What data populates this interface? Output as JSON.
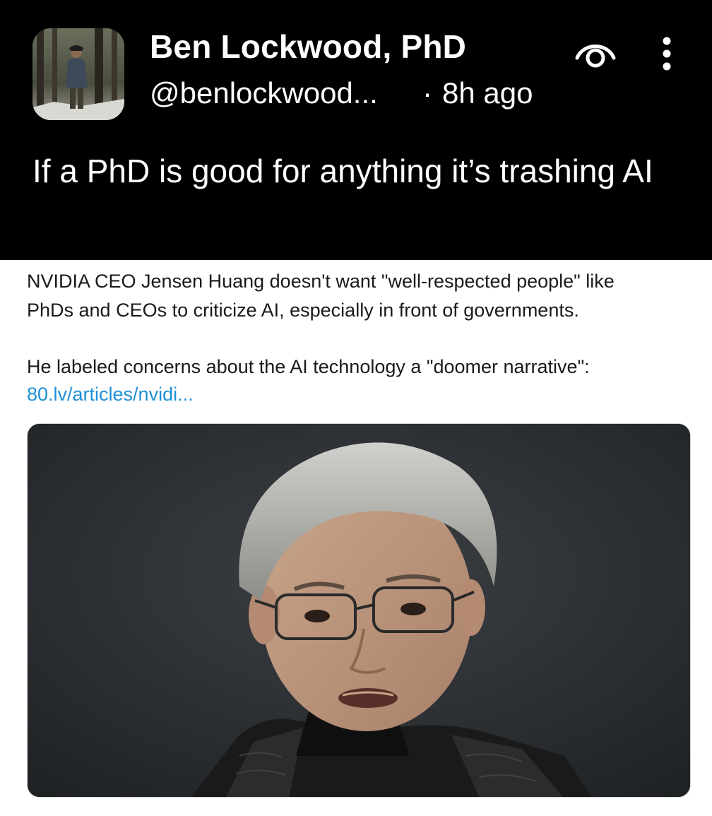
{
  "post": {
    "author_name": "Ben Lockwood, PhD",
    "handle": "@benlockwood...",
    "separator": "·",
    "time": "8h ago",
    "text": "If a PhD is good for anything it’s trashing AI",
    "icons": {
      "avatar": "avatar-photo-man-in-forest",
      "follow": "eye-icon",
      "more": "more-vertical-icon"
    }
  },
  "quoted": {
    "line1": "NVIDIA CEO Jensen Huang doesn't want \"well-respected people\" like",
    "line2": "PhDs and CEOs to criticize AI, especially in front of governments.",
    "line3": "He labeled concerns about the AI technology a \"doomer narrative\":",
    "link": "80.lv/articles/nvidi...",
    "image": "photo-man-glasses-leather-jacket"
  },
  "colors": {
    "header_bg": "#000000",
    "header_text": "#ffffff",
    "body_text": "#1a1a1a",
    "link": "#1d8fd6"
  }
}
